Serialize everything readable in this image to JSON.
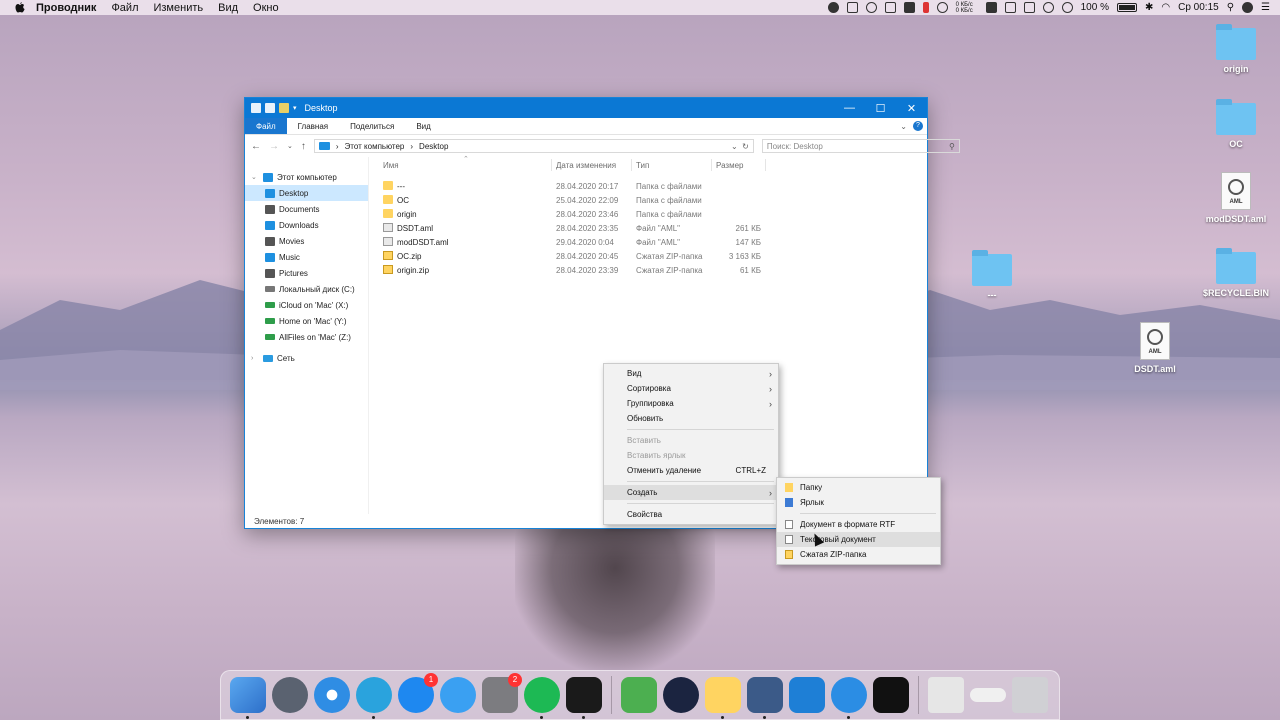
{
  "menubar": {
    "app_name": "Проводник",
    "items": [
      "Файл",
      "Изменить",
      "Вид",
      "Окно"
    ],
    "net_up": "0 КБ/с",
    "net_down": "0 КБ/с",
    "battery": "100 %",
    "clock": "Ср 00:15"
  },
  "desktop_icons": [
    {
      "label": "origin",
      "kind": "folder"
    },
    {
      "label": "OC",
      "kind": "folder"
    },
    {
      "label": "modDSDT.aml",
      "kind": "aml"
    },
    {
      "label": "$RECYCLE.BIN",
      "kind": "folder"
    },
    {
      "label": "---",
      "kind": "folder"
    },
    {
      "label": "DSDT.aml",
      "kind": "aml"
    }
  ],
  "file_badge": "AML",
  "explorer": {
    "title": "Desktop",
    "ribbon_tabs": [
      "Файл",
      "Главная",
      "Поделиться",
      "Вид"
    ],
    "help_label": "?",
    "breadcrumb": [
      "Этот компьютер",
      "Desktop"
    ],
    "search_placeholder": "Поиск: Desktop",
    "columns": {
      "name": "Имя",
      "date": "Дата изменения",
      "type": "Тип",
      "size": "Размер"
    },
    "nav": {
      "this_pc": "Этот компьютер",
      "items": [
        "Desktop",
        "Documents",
        "Downloads",
        "Movies",
        "Music",
        "Pictures",
        "Локальный диск (C:)",
        "iCloud on 'Mac' (X:)",
        "Home on 'Mac' (Y:)",
        "AllFiles on 'Mac' (Z:)"
      ],
      "network": "Сеть"
    },
    "files": [
      {
        "name": "---",
        "date": "28.04.2020 20:17",
        "type": "Папка с файлами",
        "size": "",
        "icon": "folder"
      },
      {
        "name": "OC",
        "date": "25.04.2020 22:09",
        "type": "Папка с файлами",
        "size": "",
        "icon": "folder"
      },
      {
        "name": "origin",
        "date": "28.04.2020 23:46",
        "type": "Папка с файлами",
        "size": "",
        "icon": "folder"
      },
      {
        "name": "DSDT.aml",
        "date": "28.04.2020 23:35",
        "type": "Файл \"AML\"",
        "size": "261 КБ",
        "icon": "aml"
      },
      {
        "name": "modDSDT.aml",
        "date": "29.04.2020 0:04",
        "type": "Файл \"AML\"",
        "size": "147 КБ",
        "icon": "aml"
      },
      {
        "name": "OC.zip",
        "date": "28.04.2020 20:45",
        "type": "Сжатая ZIP-папка",
        "size": "3 163 КБ",
        "icon": "zip"
      },
      {
        "name": "origin.zip",
        "date": "28.04.2020 23:39",
        "type": "Сжатая ZIP-папка",
        "size": "61 КБ",
        "icon": "zip"
      }
    ],
    "status": "Элементов: 7"
  },
  "context_menu": {
    "view": "Вид",
    "sort": "Сортировка",
    "group": "Группировка",
    "refresh": "Обновить",
    "paste": "Вставить",
    "paste_shortcut": "Вставить ярлык",
    "undo_delete": "Отменить удаление",
    "undo_shortcut": "CTRL+Z",
    "create": "Создать",
    "properties": "Свойства"
  },
  "submenu": {
    "folder": "Папку",
    "shortcut": "Ярлык",
    "rtf": "Документ в формате RTF",
    "text": "Текстовый документ",
    "zip": "Сжатая ZIP-папка"
  },
  "dock": {
    "badges": {
      "appstore": "1",
      "settings": "2"
    }
  }
}
